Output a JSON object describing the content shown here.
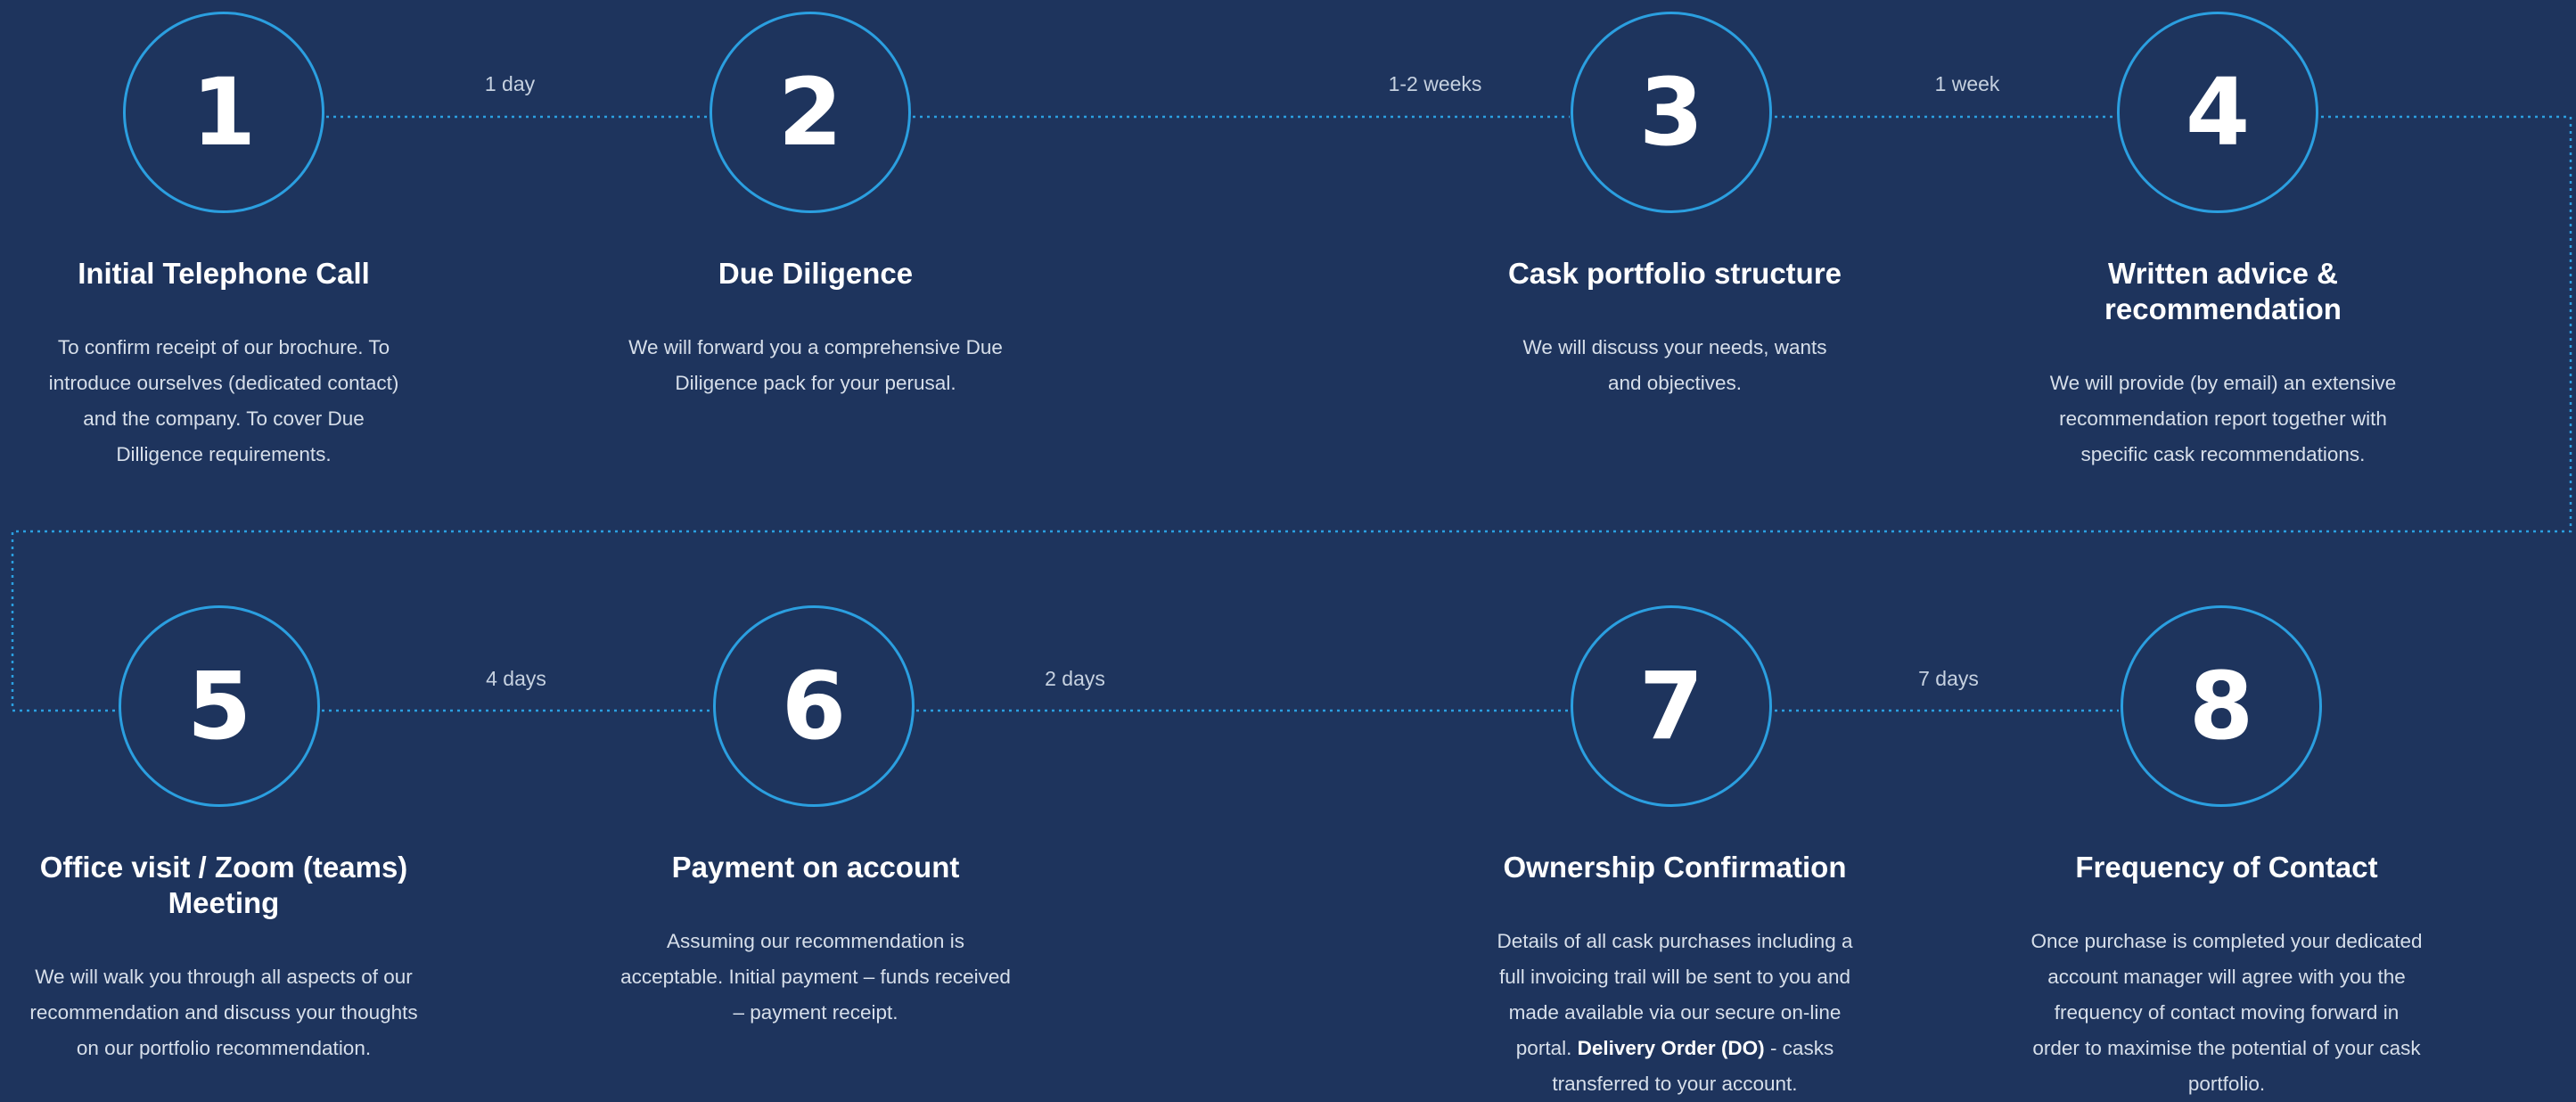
{
  "steps": [
    {
      "number": "1",
      "title": "Initial Telephone Call",
      "description": "To confirm receipt of our brochure. To introduce ourselves (dedicated contact) and the company. To cover Due Dilligence requirements."
    },
    {
      "number": "2",
      "title": "Due Diligence",
      "description": "We will forward you a comprehensive Due Diligence pack for your perusal."
    },
    {
      "number": "3",
      "title": "Cask portfolio structure",
      "description": "We will discuss your needs, wants and objectives."
    },
    {
      "number": "4",
      "title": "Written advice & recommendation",
      "description": "We will provide (by email) an extensive recommendation report together with specific cask recommendations."
    },
    {
      "number": "5",
      "title": "Office visit / Zoom (teams) Meeting",
      "description": "We will walk you through all aspects of our recommendation and discuss your thoughts on our portfolio recommendation."
    },
    {
      "number": "6",
      "title": "Payment on account",
      "description": "Assuming our recommendation is acceptable. Initial payment –  funds received – payment receipt."
    },
    {
      "number": "7",
      "title": "Ownership Confirmation",
      "description": "Details of all cask purchases including a full invoicing trail will be sent to you and made available via our secure on-line portal.",
      "description_bold": "Delivery Order (DO)",
      "description_tail": " - casks transferred to your account."
    },
    {
      "number": "8",
      "title": "Frequency of Contact",
      "description": "Once purchase is completed your dedicated account manager will agree with you the frequency of contact moving forward in order to maximise the potential of your cask portfolio."
    }
  ],
  "durations": [
    "1 day",
    "1-2 weeks",
    "1 week",
    "4 days",
    "2 days",
    "7 days"
  ],
  "colors": {
    "background": "#1e345d",
    "accent": "#2b9fe0",
    "text": "#ffffff",
    "muted_text": "#c6d1e0"
  }
}
